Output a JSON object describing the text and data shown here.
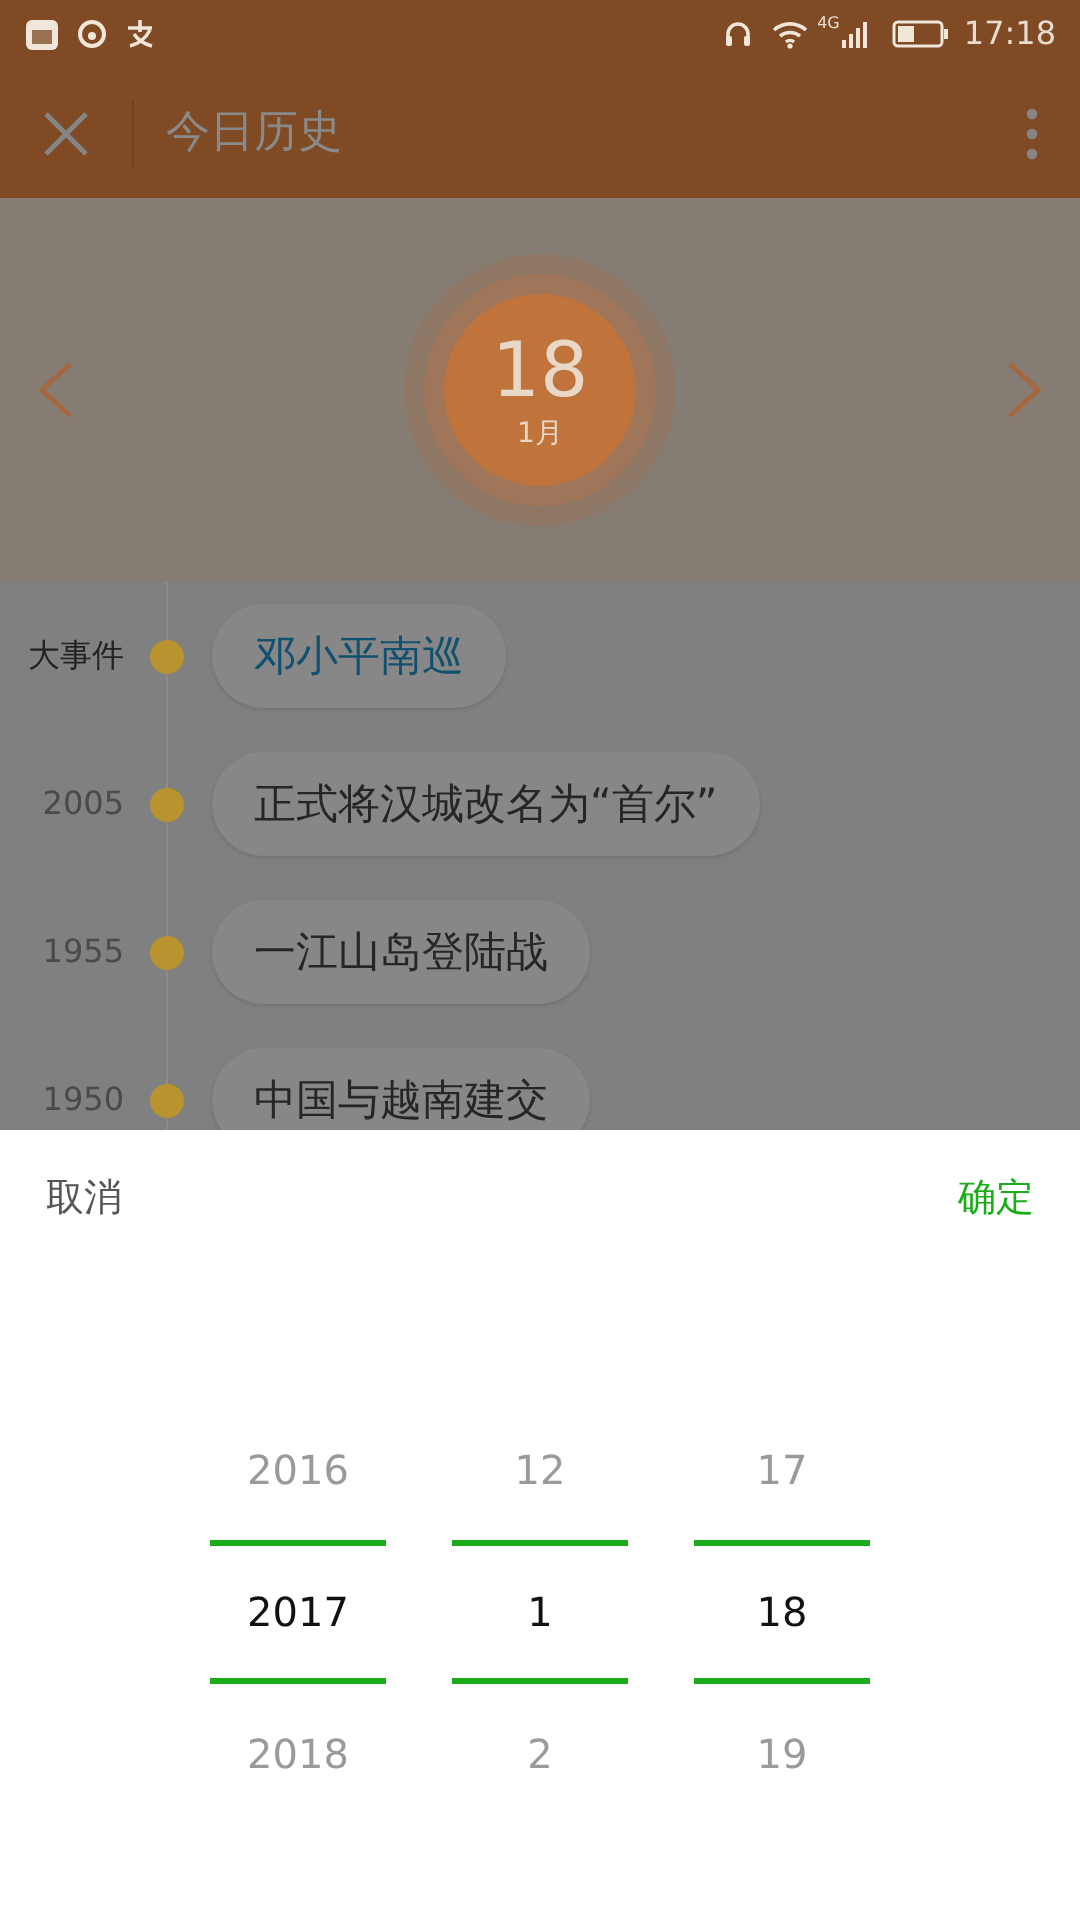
{
  "status_bar": {
    "time": "17:18",
    "network": "4G"
  },
  "header": {
    "title": "今日历史"
  },
  "date": {
    "day": "18",
    "month": "1月"
  },
  "events": [
    {
      "kind": "featured",
      "label": "大事件",
      "title": "邓小平南巡"
    },
    {
      "kind": "normal",
      "label": "2005",
      "title": "正式将汉城改名为“首尔”"
    },
    {
      "kind": "normal",
      "label": "1955",
      "title": "一江山岛登陆战"
    },
    {
      "kind": "normal",
      "label": "1950",
      "title": "中国与越南建交"
    }
  ],
  "picker": {
    "cancel": "取消",
    "confirm": "确定",
    "columns": [
      {
        "items": [
          {
            "label": "2016",
            "selected": false
          },
          {
            "label": "2017",
            "selected": true
          },
          {
            "label": "2018",
            "selected": false
          }
        ]
      },
      {
        "items": [
          {
            "label": "12",
            "selected": false
          },
          {
            "label": "1",
            "selected": true
          },
          {
            "label": "2",
            "selected": false
          }
        ]
      },
      {
        "items": [
          {
            "label": "17",
            "selected": false
          },
          {
            "label": "18",
            "selected": true
          },
          {
            "label": "19",
            "selected": false
          }
        ]
      }
    ]
  }
}
